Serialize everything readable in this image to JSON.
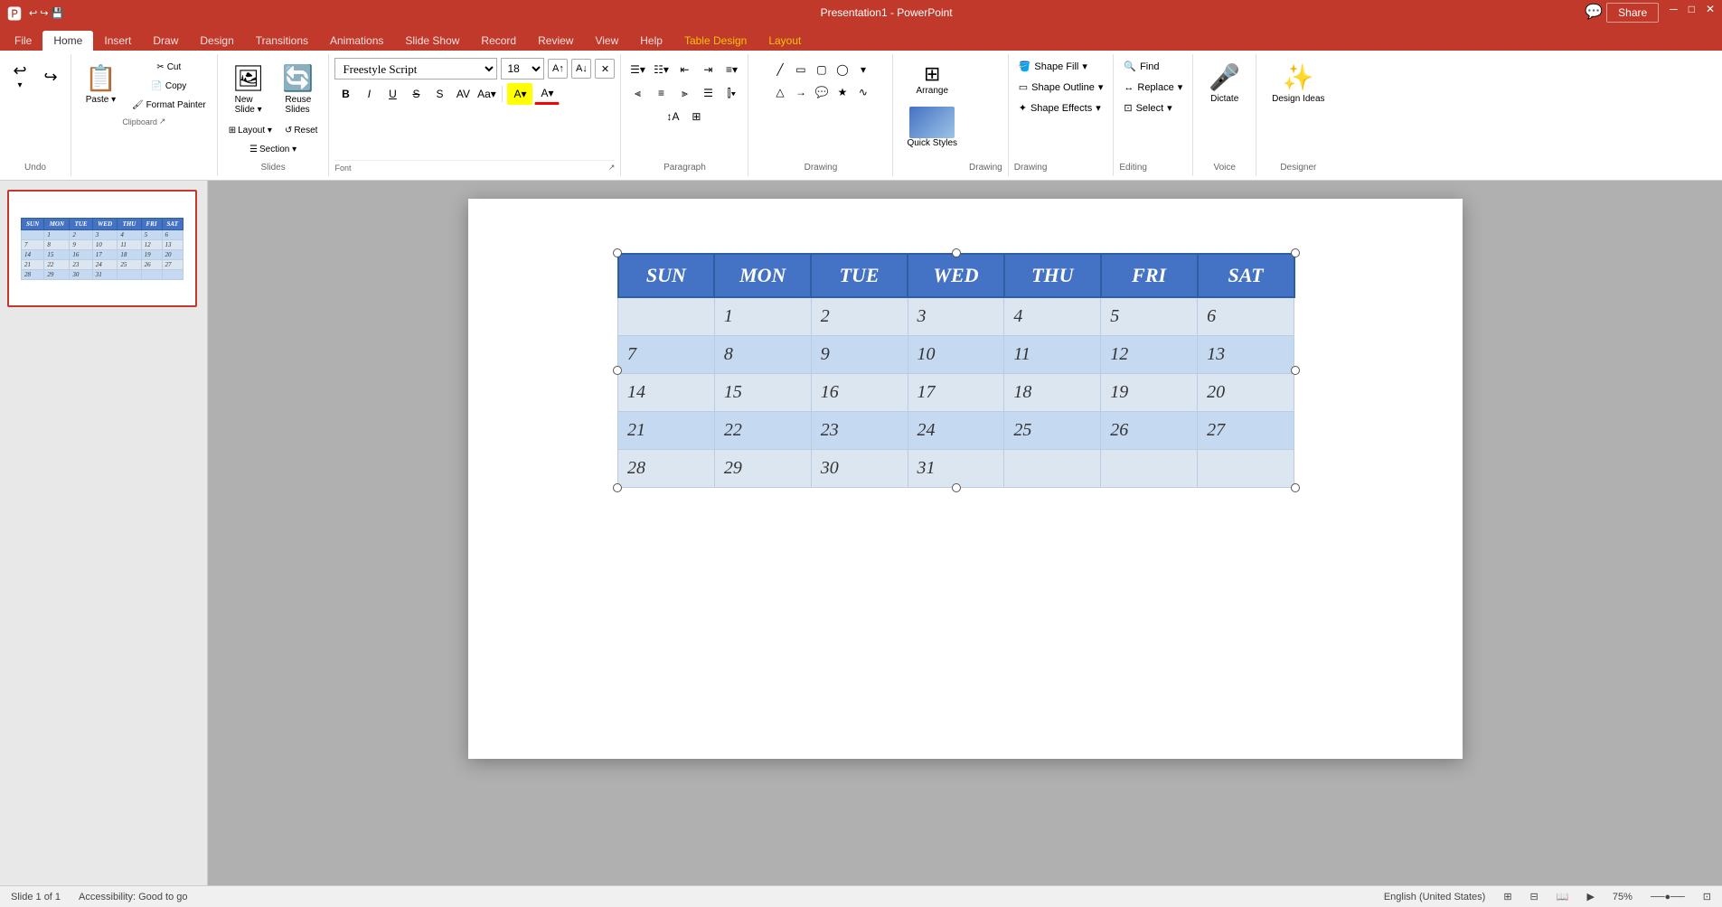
{
  "window": {
    "title": "Presentation1 - PowerPoint",
    "share_label": "Share"
  },
  "menu": {
    "items": [
      "File",
      "Home",
      "Insert",
      "Draw",
      "Design",
      "Transitions",
      "Animations",
      "Slide Show",
      "Record",
      "Review",
      "View",
      "Help",
      "Table Design",
      "Layout"
    ]
  },
  "ribbon": {
    "active_tab": "Home",
    "groups": {
      "undo": {
        "label": "Undo",
        "redo_label": "Redo"
      },
      "clipboard": {
        "label": "Clipboard",
        "paste_label": "Paste",
        "cut_label": "Cut",
        "copy_label": "Copy",
        "format_painter_label": "Format Painter"
      },
      "slides": {
        "label": "Slides",
        "new_slide_label": "New Slide",
        "layout_label": "Layout",
        "reset_label": "Reset",
        "reuse_label": "Reuse Slides",
        "section_label": "Section"
      },
      "font": {
        "label": "Font",
        "font_name": "Freestyle Script",
        "font_size": "18",
        "bold": "B",
        "italic": "I",
        "underline": "U",
        "strikethrough": "S"
      },
      "paragraph": {
        "label": "Paragraph"
      },
      "drawing": {
        "label": "Drawing"
      },
      "arrange": {
        "label": "Arrange",
        "arrange_label": "Arrange",
        "quick_styles_label": "Quick Styles"
      },
      "shape_format": {
        "fill_label": "Shape Fill",
        "outline_label": "Shape Outline",
        "effects_label": "Shape Effects"
      },
      "editing": {
        "label": "Editing",
        "find_label": "Find",
        "replace_label": "Replace",
        "select_label": "Select"
      },
      "voice": {
        "label": "Voice",
        "dictate_label": "Dictate"
      },
      "designer": {
        "label": "Designer",
        "design_ideas_label": "Design Ideas"
      }
    }
  },
  "calendar": {
    "headers": [
      "SUN",
      "MON",
      "TUE",
      "WED",
      "THU",
      "FRI",
      "SAT"
    ],
    "rows": [
      [
        "",
        "1",
        "2",
        "3",
        "4",
        "5",
        "6"
      ],
      [
        "7",
        "8",
        "9",
        "10",
        "11",
        "12",
        "13"
      ],
      [
        "14",
        "15",
        "16",
        "17",
        "18",
        "19",
        "20"
      ],
      [
        "21",
        "22",
        "23",
        "24",
        "25",
        "26",
        "27"
      ],
      [
        "28",
        "29",
        "30",
        "31",
        "",
        "",
        ""
      ]
    ]
  },
  "slide": {
    "number": "1"
  },
  "status": {
    "slide_info": "Slide 1 of 1",
    "language": "English (United States)",
    "accessibility": "Accessibility: Good to go"
  }
}
